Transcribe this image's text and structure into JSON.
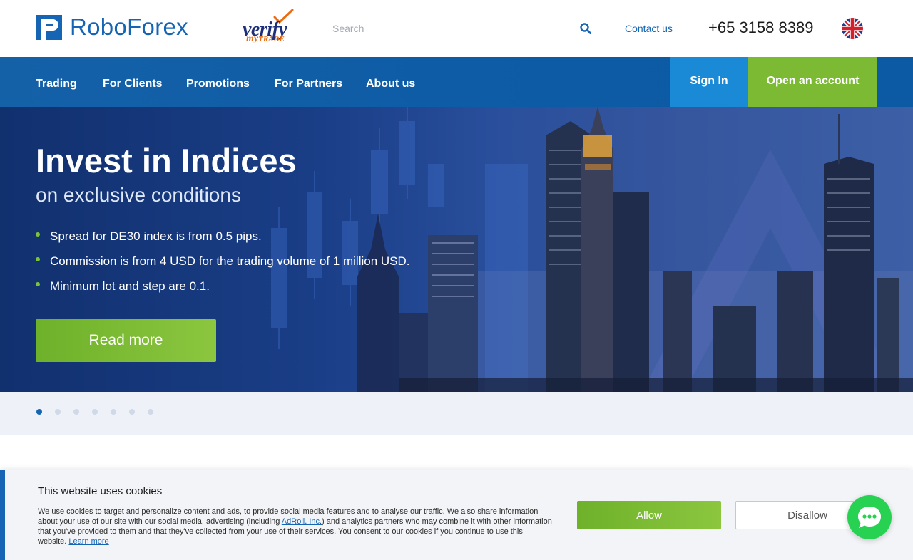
{
  "header": {
    "brand": "RoboForex",
    "verify_badge": {
      "word": "verify",
      "sub_my": "my",
      "sub_trade": "TRADE"
    },
    "search": {
      "placeholder": "Search",
      "value": ""
    },
    "contact_label": "Contact us",
    "phone": "+65 3158 8389",
    "language_icon": "uk-flag-icon"
  },
  "nav": {
    "items": [
      {
        "label": "Trading"
      },
      {
        "label": "For Clients"
      },
      {
        "label": "Promotions"
      },
      {
        "label": "For Partners"
      },
      {
        "label": "About us"
      }
    ],
    "sign_in_label": "Sign In",
    "open_account_label": "Open an account"
  },
  "hero": {
    "title": "Invest in Indices",
    "subtitle": "on exclusive conditions",
    "bullets": [
      "Spread for DE30 index is from 0.5 pips.",
      "Commission is from 4 USD for the trading volume of 1 million USD.",
      "Minimum lot and step are 0.1."
    ],
    "cta_label": "Read more"
  },
  "slider": {
    "total_slides": 7,
    "active_slide": 1
  },
  "cookie_banner": {
    "title": "This website uses cookies",
    "text_part1": "We use cookies to target and personalize content and ads, to provide social media features and to analyse our traffic. We also share information about your use of our site with our social media, advertising (including ",
    "adroll_link": "AdRoll, Inc.",
    "text_part2": ") and analytics partners who may combine it with other information that you've provided to them and that they've collected from your use of their services. You consent to our cookies if you continue to use this website. ",
    "learn_more_link": "Learn more",
    "allow_label": "Allow",
    "disallow_label": "Disallow"
  },
  "chat": {
    "icon": "chat-bubble-icon"
  },
  "colors": {
    "brand_blue": "#1565b4",
    "nav_blue": "#0d5ba5",
    "sign_in_blue": "#1a8ad6",
    "accent_green": "#7cba34",
    "chat_green": "#27d253"
  }
}
